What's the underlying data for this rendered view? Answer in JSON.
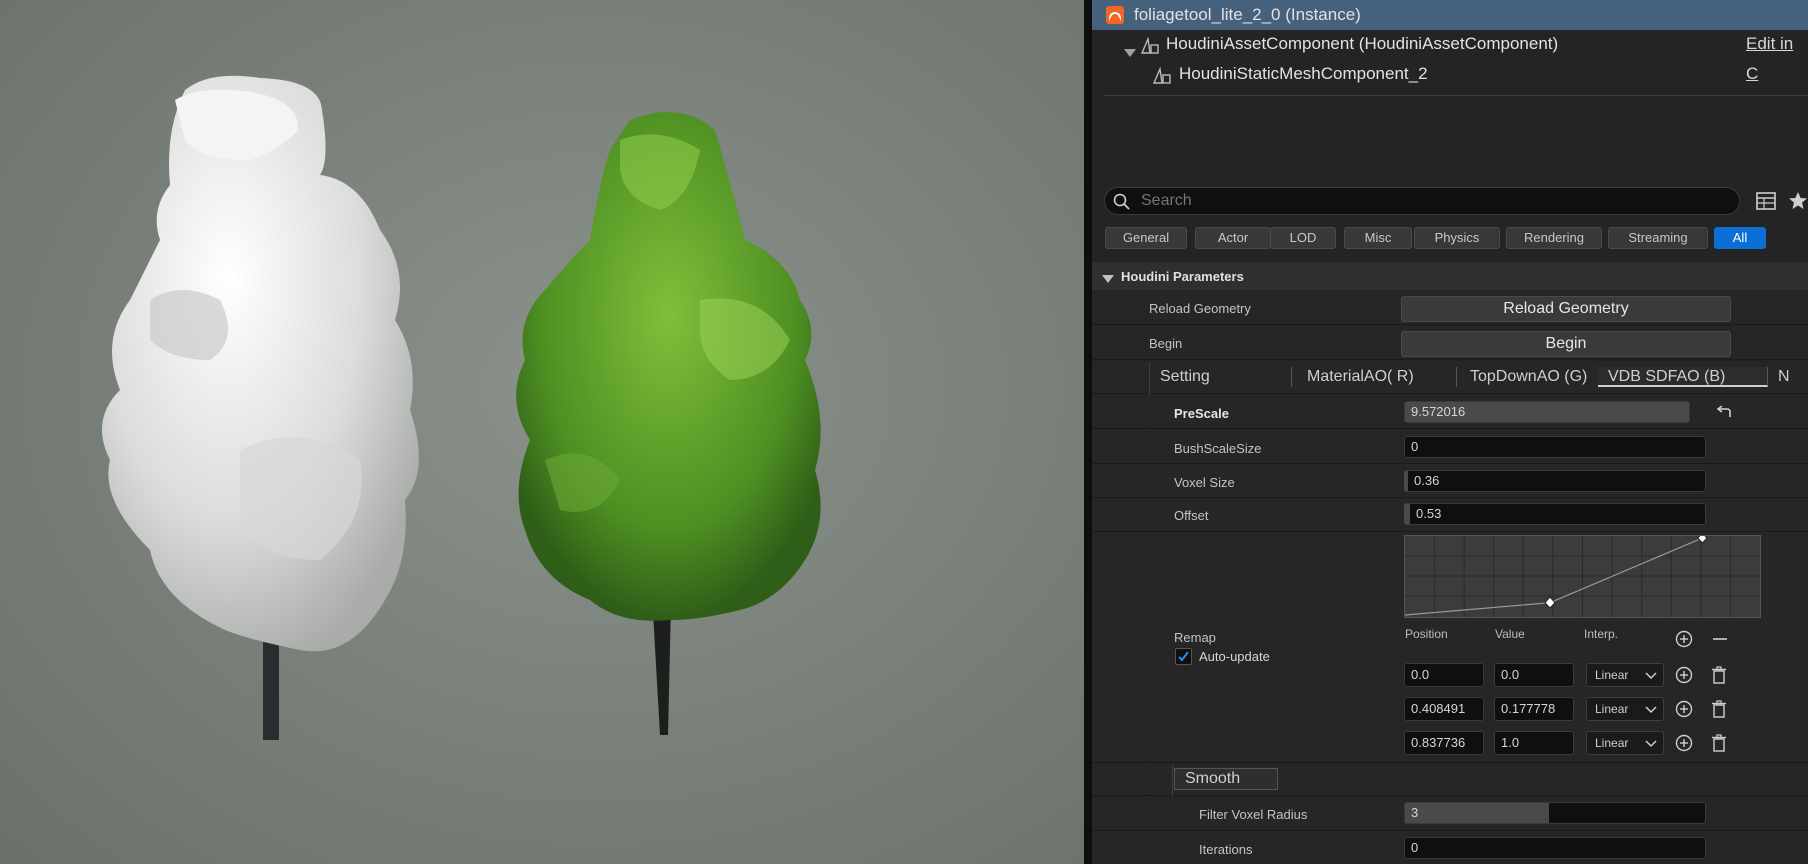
{
  "outliner": {
    "root_label": "foliagetool_lite_2_0 (Instance)",
    "component_label": "HoudiniAssetComponent (HoudiniAssetComponent)",
    "mesh_label": "HoudiniStaticMeshComponent_2",
    "edit_link": "Edit in C"
  },
  "search": {
    "placeholder": "Search"
  },
  "filters": [
    "General",
    "Actor",
    "LOD",
    "Misc",
    "Physics",
    "Rendering",
    "Streaming",
    "All"
  ],
  "section": {
    "title": "Houdini Parameters"
  },
  "buttons": {
    "reload_label": "Reload Geometry",
    "reload_button": "Reload Geometry",
    "begin_label": "Begin",
    "begin_button": "Begin"
  },
  "tabs": [
    "Setting",
    "MaterialAO( R)",
    "TopDownAO (G)",
    "VDB SDFAO (B)",
    "N"
  ],
  "params": {
    "prescale_label": "PreScale",
    "prescale_value": "9.572016",
    "bushscale_label": "BushScaleSize",
    "bushscale_value": "0",
    "voxel_label": "Voxel Size",
    "voxel_value": "0.36",
    "offset_label": "Offset",
    "offset_value": "0.53",
    "remap_label": "Remap",
    "autoupdate_label": "Auto-update",
    "smooth_label": "Smooth",
    "filter_label": "Filter Voxel Radius",
    "filter_value": "3",
    "iterations_label": "Iterations",
    "iterations_value": "0"
  },
  "ramp": {
    "headers": {
      "position": "Position",
      "value": "Value",
      "interp": "Interp."
    },
    "points": [
      {
        "position": "0.0",
        "value": "0.0",
        "interp": "Linear"
      },
      {
        "position": "0.408491",
        "value": "0.177778",
        "interp": "Linear"
      },
      {
        "position": "0.837736",
        "value": "1.0",
        "interp": "Linear"
      }
    ]
  },
  "colors": {
    "selection": "#46617c",
    "accent": "#0b6fd6",
    "houdini_orange": "#f26522"
  },
  "icons": [
    "houdini-logo-icon",
    "component-icon",
    "mesh-icon",
    "search-icon",
    "table-view-icon",
    "star-icon",
    "collapse-arrow-icon",
    "reset-icon",
    "add-point-icon",
    "remove-point-icon",
    "trash-icon",
    "checkbox-check-icon",
    "chevron-down-icon"
  ]
}
